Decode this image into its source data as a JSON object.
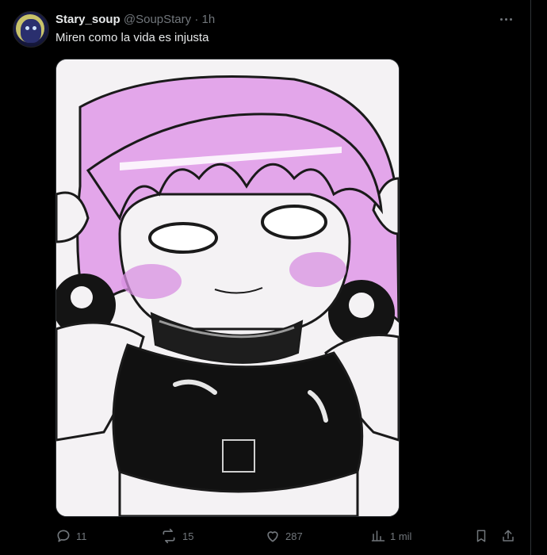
{
  "author": {
    "display_name": "Stary_soup",
    "handle": "@SoupStary",
    "separator": "·",
    "time": "1h"
  },
  "tweet": {
    "text": "Miren como la vida es injusta"
  },
  "media": {
    "kind": "illustration",
    "description_icon": "anime-girl-sketch-image"
  },
  "actions": {
    "replies": "11",
    "reposts": "15",
    "likes": "287",
    "views": "1 mil"
  },
  "colors": {
    "background": "#000000",
    "text_primary": "#e7e9ea",
    "text_secondary": "#71767b",
    "border": "#2f3336",
    "hair_pink": "#e3a6ea"
  }
}
